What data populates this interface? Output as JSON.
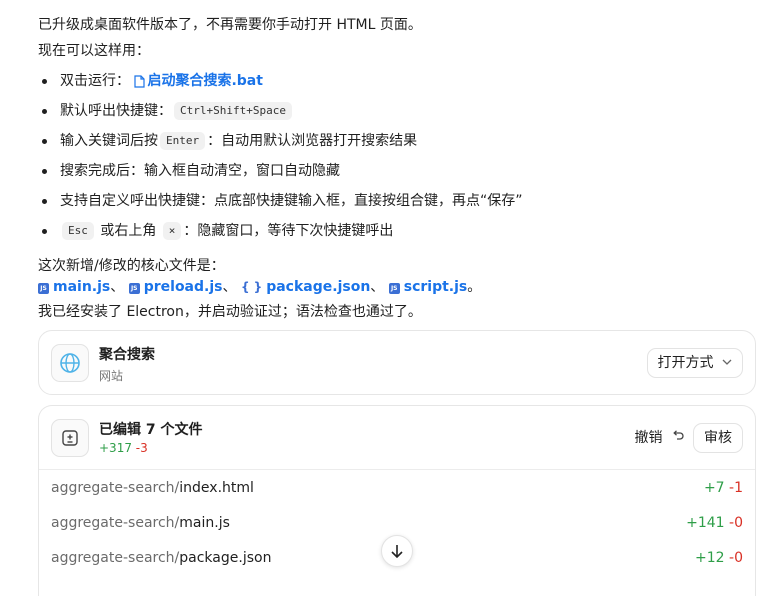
{
  "message": {
    "line1": "已升级成桌面软件版本了，不再需要你手动打开 HTML 页面。",
    "line2": "现在可以这样用：",
    "bullets": {
      "b1_prefix": "双击运行：",
      "b1_link": "启动聚合搜索.bat",
      "b2_prefix": "默认呼出快捷键：",
      "b2_kbd": "Ctrl+Shift+Space",
      "b3_prefix": "输入关键词后按",
      "b3_kbd": "Enter",
      "b3_suffix": "：自动用默认浏览器打开搜索结果",
      "b4": "搜索完成后：输入框自动清空，窗口自动隐藏",
      "b5": "支持自定义呼出快捷键：点底部快捷键输入框，直接按组合键，再点“保存”",
      "b6_kbd1": "Esc",
      "b6_mid": "或右上角",
      "b6_kbd2": "×",
      "b6_suffix": "：隐藏窗口，等待下次快捷键呼出"
    },
    "files_intro": "这次新增/修改的核心文件是：",
    "files": {
      "f1": "main.js",
      "f2": "preload.js",
      "f3": "package.json",
      "f4": "script.js",
      "sep": "、",
      "end": "。",
      "js_badge": "JS",
      "json_badge": "{ }"
    },
    "closing": "我已经安装了 Electron，并启动验证过；语法检查也通过了。"
  },
  "site_card": {
    "title": "聚合搜索",
    "subtitle": "网站",
    "open_with": "打开方式",
    "icon": "globe-icon"
  },
  "edits_card": {
    "title": "已编辑 7 个文件",
    "added": "+317",
    "removed": "-3",
    "undo": "撤销",
    "review": "审核",
    "files": [
      {
        "path": "aggregate-search/",
        "name": "index.html",
        "added": "+7",
        "removed": "-1"
      },
      {
        "path": "aggregate-search/",
        "name": "main.js",
        "added": "+141",
        "removed": "-0"
      },
      {
        "path": "aggregate-search/",
        "name": "package.json",
        "added": "+12",
        "removed": "-0"
      }
    ]
  },
  "colors": {
    "link": "#1a73e8",
    "add": "#2e9e48",
    "del": "#d93025",
    "globe": "#4fb3e8"
  }
}
